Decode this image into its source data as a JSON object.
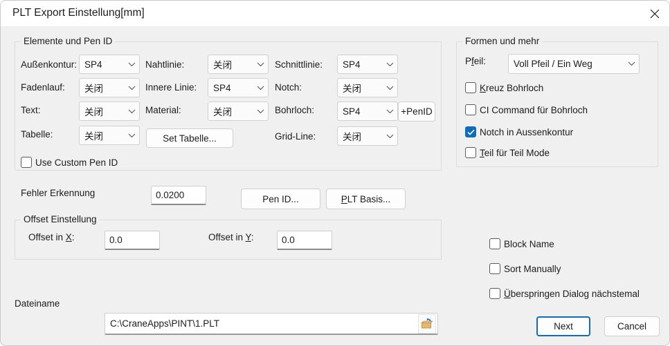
{
  "window": {
    "title": "PLT Export Einstellung[mm]",
    "close_icon": "close-icon"
  },
  "accent_color": "#0f6cbd",
  "background_color": "#f0f0f0",
  "elements_group": {
    "title": "Elemente und Pen ID",
    "fields": [
      {
        "label": "Außenkontur:",
        "value": "SP4"
      },
      {
        "label": "Fadenlauf:",
        "value": "关闭"
      },
      {
        "label": "Text:",
        "value": "关闭"
      },
      {
        "label": "Tabelle:",
        "value": "关闭"
      },
      {
        "label": "Nahtlinie:",
        "value": "关闭"
      },
      {
        "label": "Innere Linie:",
        "value": "SP4"
      },
      {
        "label": "Material:",
        "value": "关闭"
      },
      {
        "label": "Schnittlinie:",
        "value": "SP4"
      },
      {
        "label": "Notch:",
        "value": "关闭"
      },
      {
        "label": "Bohrloch:",
        "value": "SP4"
      },
      {
        "label": "Grid-Line:",
        "value": "关闭"
      }
    ],
    "set_tabelle_button": "Set Tabelle...",
    "pen_id_plus_button": "+PenID",
    "use_custom_pen_id": {
      "label": "Use Custom Pen ID",
      "checked": false
    }
  },
  "shapes_group": {
    "title": "Formen und mehr",
    "arrow_label": "Pfeil:",
    "arrow_label_accel": "f",
    "arrow_value": "Voll Pfeil / Ein Weg",
    "checkboxes": [
      {
        "label": "Kreuz Bohrloch",
        "accel": "K",
        "checked": false
      },
      {
        "label": "CI Command für Bohrloch",
        "accel": "",
        "checked": false
      },
      {
        "label": "Notch in Aussenkontur",
        "accel": "",
        "checked": true
      },
      {
        "label": "Teil für Teil Mode",
        "accel": "T",
        "checked": false
      }
    ]
  },
  "error_row": {
    "label": "Fehler Erkennung",
    "value": "0.0200",
    "pen_id_button": "Pen ID...",
    "plt_basis_button": "PLT Basis...",
    "plt_basis_accel": "P"
  },
  "offset_group": {
    "title": "Offset Einstellung",
    "x_label_pre": "Offset in ",
    "x_label_accel": "X",
    "x_label_post": ":",
    "x_value": "0.0",
    "y_label_pre": "Offset in ",
    "y_label_accel": "Y",
    "y_label_post": ":",
    "y_value": "0.0"
  },
  "bottom_options": [
    {
      "label": "Block Name",
      "accel": "",
      "checked": false
    },
    {
      "label": "Sort Manually",
      "accel": "",
      "checked": false
    },
    {
      "label": "Überspringen Dialog nächstemal",
      "accel": "Ü",
      "checked": false
    }
  ],
  "filename": {
    "label": "Dateiname",
    "value": "C:\\CraneApps\\PINT\\1.PLT",
    "browse_icon": "open-folder-icon"
  },
  "footer": {
    "next_button": "Next",
    "cancel_button": "Cancel"
  }
}
